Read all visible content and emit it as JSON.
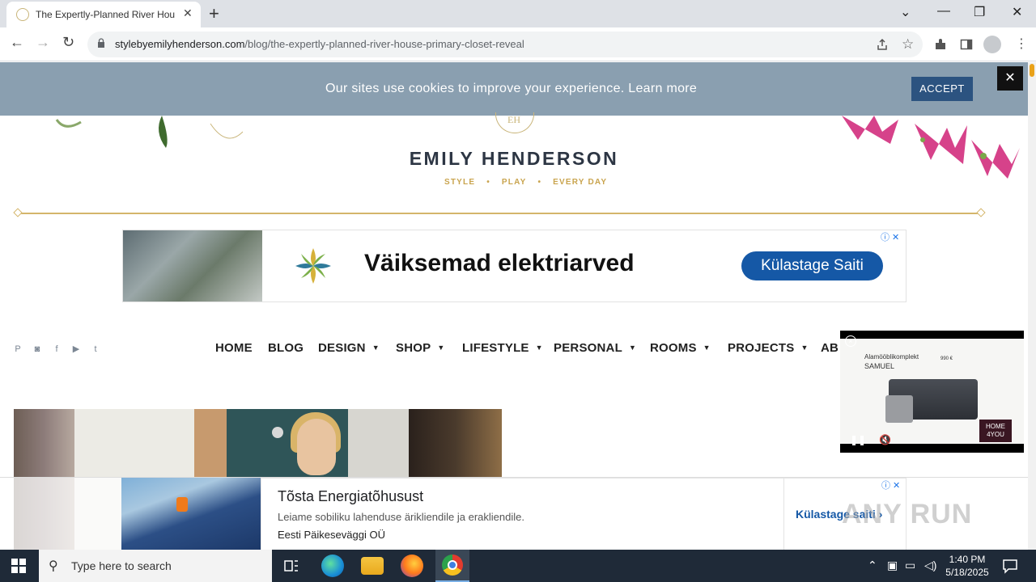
{
  "browser": {
    "tab_title": "The Expertly-Planned River Hou",
    "tab_close": "✕",
    "new_tab": "+",
    "url_domain": "stylebyemilyhenderson.com",
    "url_path": "/blog/the-expertly-planned-river-house-primary-closet-reveal",
    "back": "←",
    "forward": "→",
    "reload": "↻",
    "minimize": "—",
    "maximize": "❐",
    "close": "✕",
    "dropdown": "⌄"
  },
  "cookie": {
    "message": "Our sites use cookies to improve your experience. Learn more",
    "accept_label": "ACCEPT",
    "close_label": "✕"
  },
  "site": {
    "monogram": "EH",
    "brand": "EMILY HENDERSON",
    "tagline": [
      "STYLE",
      "•",
      "PLAY",
      "•",
      "EVERY DAY"
    ]
  },
  "ad_top": {
    "headline": "Väiksemad elektriarved",
    "cta": "Külastage Saiti",
    "adchoices": "ⓘ ✕"
  },
  "social": [
    "P",
    "◙",
    "f",
    "▶",
    "t"
  ],
  "nav": [
    {
      "label": "HOME",
      "caret": ""
    },
    {
      "label": "BLOG",
      "caret": ""
    },
    {
      "label": "DESIGN",
      "caret": "▼"
    },
    {
      "label": "SHOP",
      "caret": "▼"
    },
    {
      "label": "LIFESTYLE",
      "caret": "▼"
    },
    {
      "label": "PERSONAL",
      "caret": "▼"
    },
    {
      "label": "ROOMS",
      "caret": "▼"
    },
    {
      "label": "PROJECTS",
      "caret": "▼"
    },
    {
      "label": "AB",
      "caret": ""
    }
  ],
  "video_ad": {
    "title1": "Alamööblikomplekt",
    "title2": "SAMUEL",
    "price": "990 €",
    "brand": "HOME 4YOU",
    "close": "×",
    "pause": "❚❚",
    "mute": "🔇"
  },
  "ad_bottom": {
    "headline": "Tõsta Energiatõhusust",
    "description": "Leiame sobiliku lahenduse ärikliendile ja erakliendile.",
    "sponsor": "Eesti Päikeseväggi OÜ",
    "cta": "Külastage saiti",
    "adchoices": "ⓘ ✕"
  },
  "watermark": "ANY RUN",
  "taskbar": {
    "search_placeholder": "Type here to search",
    "time": "1:40 PM",
    "date": "5/18/2025"
  },
  "colors": {
    "cookie_bar": "#8a9fb0",
    "accent_gold": "#c9a44e",
    "cta_blue": "#1558a6",
    "taskbar": "#1f2a38"
  }
}
